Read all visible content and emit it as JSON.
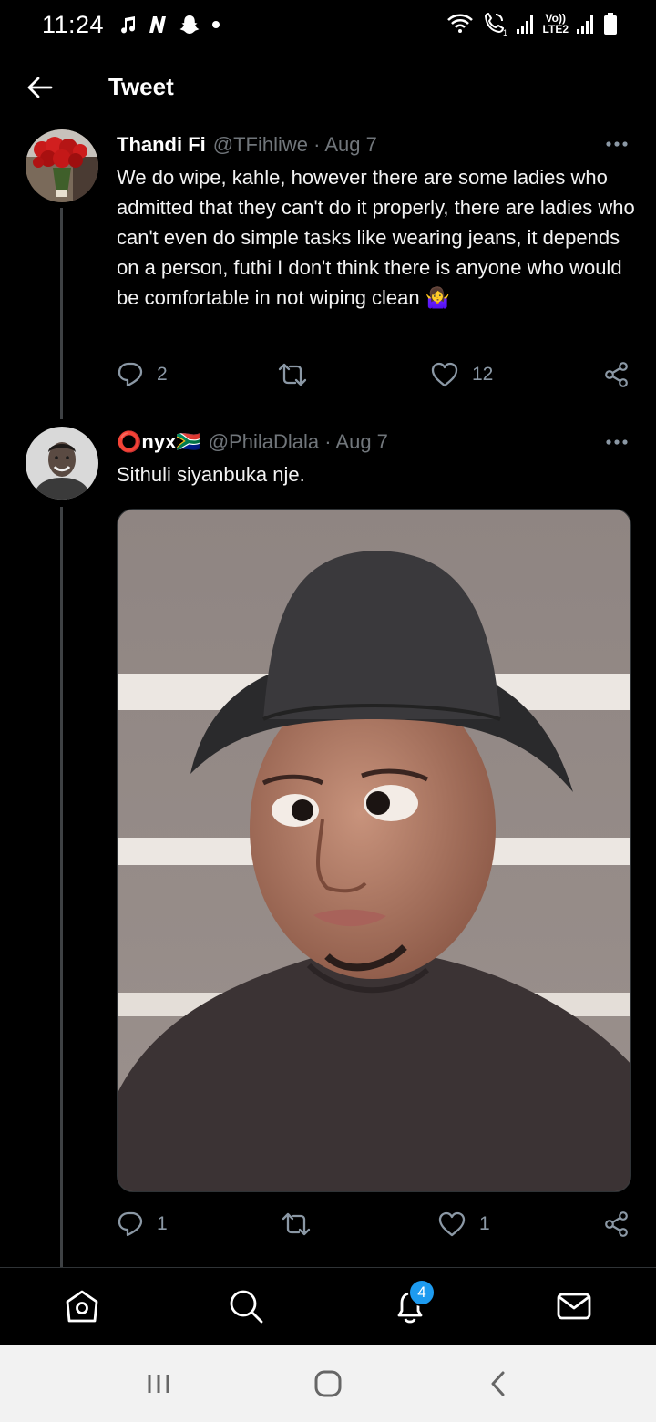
{
  "status_bar": {
    "time": "11:24",
    "left_icons": [
      "music-note-icon",
      "netflix-icon",
      "snapchat-icon",
      "dot-icon"
    ],
    "right_icons": [
      "wifi-icon",
      "wifi-calling-icon",
      "signal-icon",
      "volte-icon",
      "signal-icon",
      "battery-icon"
    ],
    "volte_top": "Vo))",
    "volte_bottom": "LTE2"
  },
  "header": {
    "title": "Tweet",
    "back_icon": "arrow-left-icon"
  },
  "tweets": [
    {
      "name": "Thandi Fi",
      "handle_date": "@TFihliwe · Aug 7",
      "text": "We do wipe, kahle, however there are some ladies who admitted that they can't do it properly, there are ladies who can't even do simple tasks like wearing jeans, it depends on a person, futhi I don't think there is anyone who would be comfortable in not wiping clean 🤷‍♀️",
      "avatar": "roses-avatar",
      "replies": "2",
      "retweets": "",
      "likes": "12"
    },
    {
      "name": "⭕nyx🇿🇦",
      "handle_date": "@PhilaDlala · Aug 7",
      "text": "Sithuli siyanbuka nje.",
      "avatar": "man-avatar",
      "media": "photo-person-bucket-hat",
      "replies": "1",
      "retweets": "",
      "likes": "1"
    }
  ],
  "bottom_nav": {
    "items": [
      "home-icon",
      "search-icon",
      "notifications-icon",
      "messages-icon"
    ],
    "notification_count": "4",
    "accent_color": "#1d9bf0"
  },
  "system_nav": {
    "items": [
      "recents-icon",
      "home-button-icon",
      "back-icon"
    ]
  },
  "colors": {
    "background": "#000000",
    "text": "#e7e9ea",
    "secondary_text": "#71767b",
    "icon": "#8b98a5"
  }
}
